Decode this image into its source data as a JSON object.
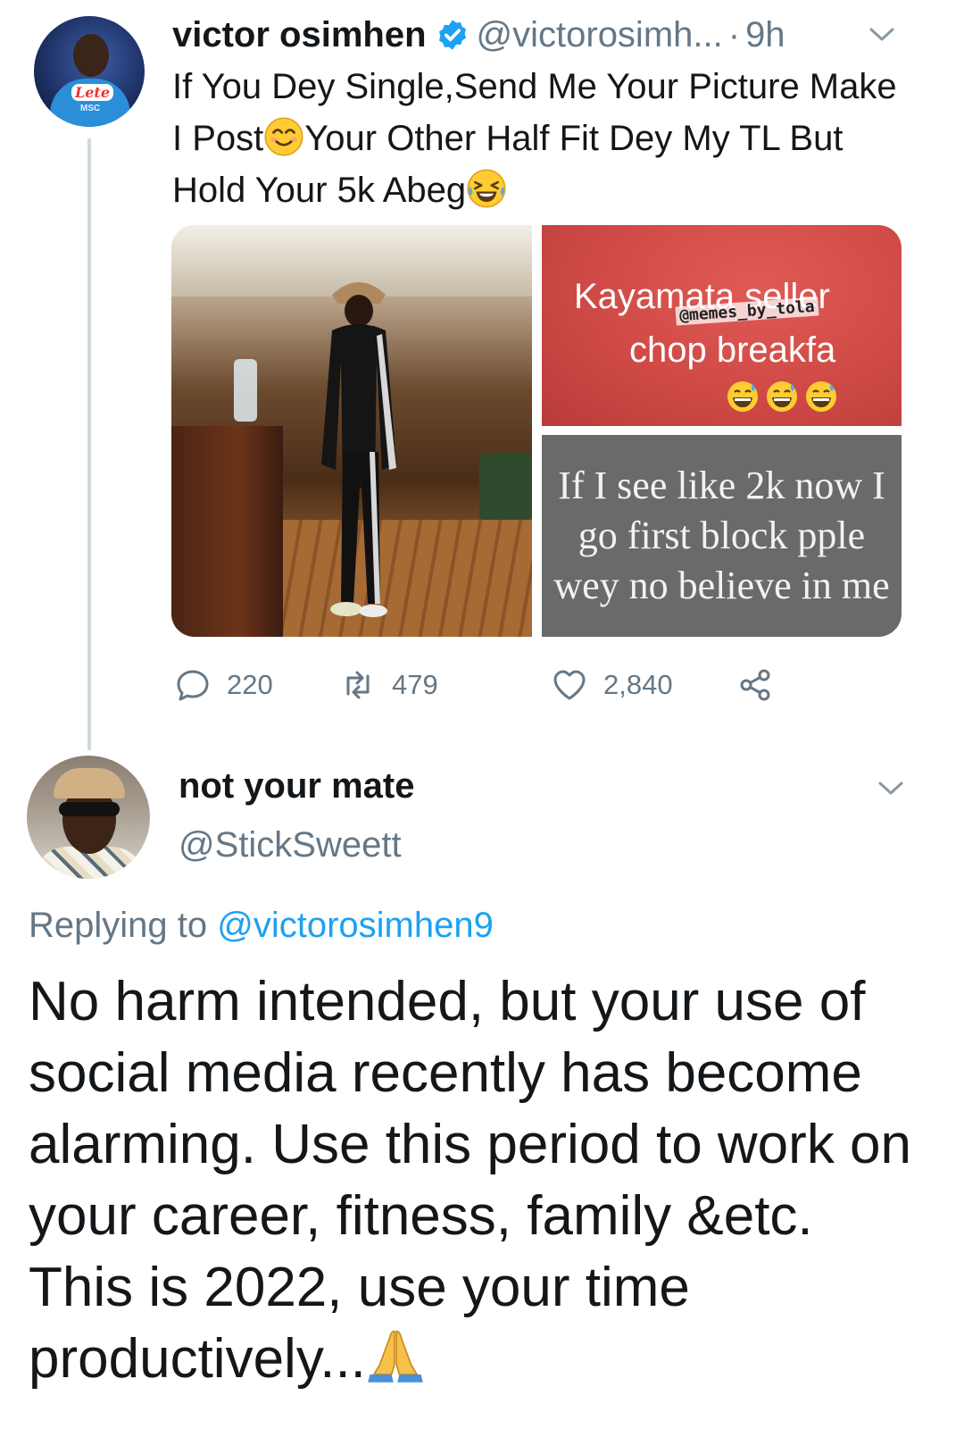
{
  "tweet": {
    "author_name": "victor osimhen",
    "author_handle": "@victorosimh...",
    "separator": "·",
    "time": "9h",
    "avatar_text": {
      "crest": "Lete",
      "sponsor": "MSC"
    },
    "text_parts": [
      "If You Dey Single,Send Me Your Picture Make I Post",
      "Your Other Half Fit Dey My TL But Hold Your 5k Abeg"
    ],
    "emojis": [
      "smiling-face-emoji",
      "tears-of-joy-emoji"
    ],
    "media": {
      "image_top_line1": "Kayamata seller",
      "image_top_line2": "chop breakfa",
      "image_top_watermark": "@memes_by_tola",
      "image_bottom_text": "If I see like 2k now I go first block pple wey no believe in me"
    },
    "stats": {
      "replies": "220",
      "retweets": "479",
      "likes": "2,840"
    }
  },
  "reply": {
    "author_name": "not your mate",
    "author_handle": "@StickSweett",
    "replying_prefix": "Replying to",
    "replying_to": "@victorosimhen9",
    "text": "No harm intended, but your use of social media recently has become alarming. Use this period to work on your career, fitness, family &etc. This is 2022, use your time productively...",
    "emoji": "folded-hands-emoji"
  },
  "colors": {
    "text": "#14171a",
    "secondary": "#657786",
    "link": "#1da1f2",
    "verified": "#1da1f2",
    "thread_line": "#cfd9de"
  }
}
